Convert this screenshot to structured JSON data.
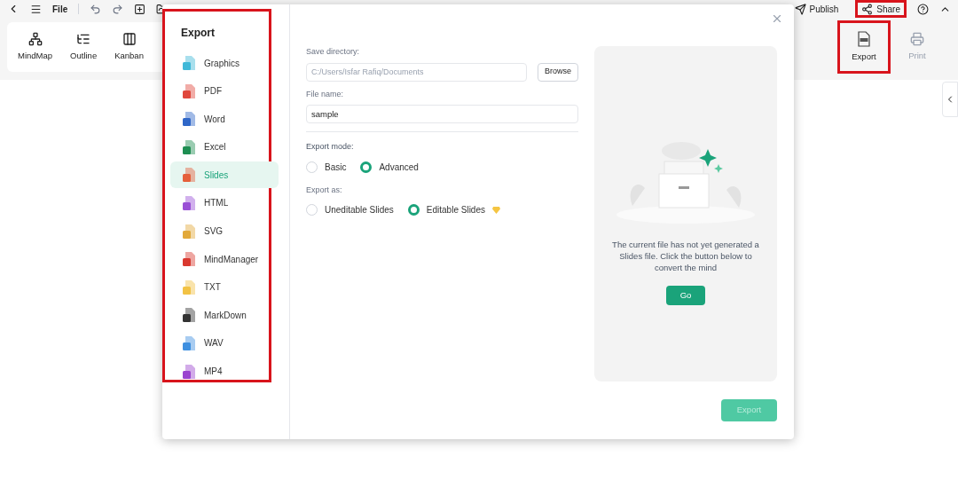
{
  "toolbar": {
    "file_menu": "File"
  },
  "top_actions": [
    {
      "kind": "publish",
      "label": "Publish",
      "highlighted": false
    },
    {
      "kind": "share",
      "label": "Share",
      "highlighted": true
    }
  ],
  "views": [
    {
      "kind": "mindmap",
      "label": "MindMap"
    },
    {
      "kind": "outline",
      "label": "Outline"
    },
    {
      "kind": "kanban",
      "label": "Kanban"
    }
  ],
  "ribbon_right": [
    {
      "kind": "export",
      "label": "Export",
      "disabled": false,
      "highlighted": true
    },
    {
      "kind": "print",
      "label": "Print",
      "disabled": true,
      "highlighted": false
    }
  ],
  "dialog": {
    "title": "Export",
    "sidebar_highlighted": true,
    "formats": [
      {
        "label": "Graphics",
        "color": "#3fb8d8",
        "selected": false
      },
      {
        "label": "PDF",
        "color": "#e0473c",
        "selected": false
      },
      {
        "label": "Word",
        "color": "#2f67c8",
        "selected": false
      },
      {
        "label": "Excel",
        "color": "#1e8e52",
        "selected": false
      },
      {
        "label": "Slides",
        "color": "#e5603b",
        "selected": true
      },
      {
        "label": "HTML",
        "color": "#9a4fd6",
        "selected": false
      },
      {
        "label": "SVG",
        "color": "#e2a93a",
        "selected": false
      },
      {
        "label": "MindManager",
        "color": "#d9392f",
        "selected": false
      },
      {
        "label": "TXT",
        "color": "#f2c244",
        "selected": false
      },
      {
        "label": "MarkDown",
        "color": "#333333",
        "selected": false
      },
      {
        "label": "WAV",
        "color": "#3d8fe0",
        "selected": false
      },
      {
        "label": "MP4",
        "color": "#9b45cf",
        "selected": false
      }
    ],
    "save_directory": {
      "label": "Save directory:",
      "placeholder": "C:/Users/Isfar Rafiq/Documents",
      "browse": "Browse"
    },
    "file_name": {
      "label": "File name:",
      "value": "sample"
    },
    "export_mode": {
      "label": "Export mode:",
      "options": [
        {
          "label": "Basic",
          "selected": false,
          "premium": false
        },
        {
          "label": "Advanced",
          "selected": true,
          "premium": false
        }
      ]
    },
    "export_as": {
      "label": "Export as:",
      "options": [
        {
          "label": "Uneditable Slides",
          "selected": false,
          "premium": false
        },
        {
          "label": "Editable Slides",
          "selected": true,
          "premium": true
        }
      ]
    },
    "preview": {
      "message": "The current file has not yet generated a Slides file. Click the button below to convert the mind",
      "go": "Go"
    },
    "export_button": {
      "label": "Export",
      "disabled": true
    }
  }
}
